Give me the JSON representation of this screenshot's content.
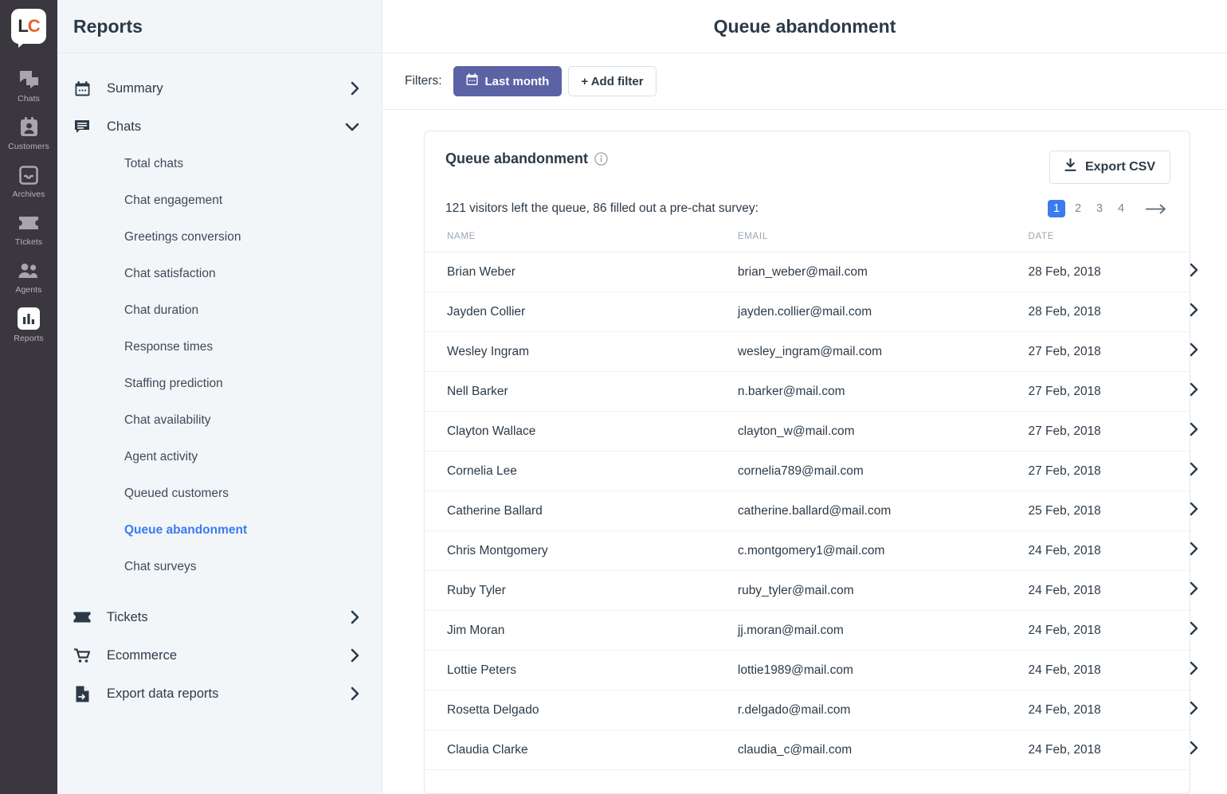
{
  "rail": {
    "logo": {
      "left": "L",
      "right": "C",
      "name": "livechat-logo"
    },
    "items": [
      {
        "label": "Chats",
        "icon": "chats-icon",
        "active": false
      },
      {
        "label": "Customers",
        "icon": "customers-icon",
        "active": false
      },
      {
        "label": "Archives",
        "icon": "archives-icon",
        "active": false
      },
      {
        "label": "TIckets",
        "icon": "tickets-icon",
        "active": false
      },
      {
        "label": "Agents",
        "icon": "agents-icon",
        "active": false
      },
      {
        "label": "Reports",
        "icon": "reports-icon",
        "active": true
      }
    ]
  },
  "sidebar": {
    "title": "Reports",
    "groups": [
      {
        "label": "Summary",
        "icon": "calendar-icon",
        "chevron": "right"
      },
      {
        "label": "Chats",
        "icon": "chat-bubble-icon",
        "chevron": "down"
      }
    ],
    "chats_sub": [
      {
        "label": "Total chats",
        "active": false
      },
      {
        "label": "Chat engagement",
        "active": false
      },
      {
        "label": "Greetings conversion",
        "active": false
      },
      {
        "label": "Chat satisfaction",
        "active": false
      },
      {
        "label": "Chat duration",
        "active": false
      },
      {
        "label": "Response times",
        "active": false
      },
      {
        "label": "Staffing prediction",
        "active": false
      },
      {
        "label": "Chat availability",
        "active": false
      },
      {
        "label": "Agent activity",
        "active": false
      },
      {
        "label": "Queued customers",
        "active": false
      },
      {
        "label": "Queue abandonment",
        "active": true
      },
      {
        "label": "Chat surveys",
        "active": false
      }
    ],
    "groups_bottom": [
      {
        "label": "Tickets",
        "icon": "ticket-icon",
        "chevron": "right"
      },
      {
        "label": "Ecommerce",
        "icon": "cart-icon",
        "chevron": "right"
      },
      {
        "label": "Export data reports",
        "icon": "export-file-icon",
        "chevron": "right"
      }
    ]
  },
  "header": {
    "title": "Queue abandonment"
  },
  "filters": {
    "label": "Filters:",
    "active_filter": "Last month",
    "add_filter": "+ Add filter"
  },
  "card": {
    "title": "Queue abandonment",
    "export_label": "Export CSV",
    "summary": "121 visitors left the queue, 86 filled out a pre-chat survey:",
    "pagination": {
      "pages": [
        "1",
        "2",
        "3",
        "4"
      ],
      "current": "1",
      "next_icon": "arrow-right-icon"
    },
    "columns": [
      "NAME",
      "EMAIL",
      "DATE"
    ],
    "rows": [
      {
        "name": "Brian Weber",
        "email": "brian_weber@mail.com",
        "date": "28 Feb, 2018"
      },
      {
        "name": "Jayden Collier",
        "email": "jayden.collier@mail.com",
        "date": "28 Feb, 2018"
      },
      {
        "name": "Wesley Ingram",
        "email": "wesley_ingram@mail.com",
        "date": "27 Feb, 2018"
      },
      {
        "name": "Nell Barker",
        "email": "n.barker@mail.com",
        "date": "27 Feb, 2018"
      },
      {
        "name": "Clayton Wallace",
        "email": "clayton_w@mail.com",
        "date": "27 Feb, 2018"
      },
      {
        "name": "Cornelia Lee",
        "email": "cornelia789@mail.com",
        "date": "27 Feb, 2018"
      },
      {
        "name": "Catherine Ballard",
        "email": "catherine.ballard@mail.com",
        "date": "25 Feb, 2018"
      },
      {
        "name": "Chris Montgomery",
        "email": "c.montgomery1@mail.com",
        "date": "24 Feb, 2018"
      },
      {
        "name": "Ruby Tyler",
        "email": "ruby_tyler@mail.com",
        "date": "24 Feb, 2018"
      },
      {
        "name": "Jim Moran",
        "email": "jj.moran@mail.com",
        "date": "24 Feb, 2018"
      },
      {
        "name": "Lottie Peters",
        "email": "lottie1989@mail.com",
        "date": "24 Feb, 2018"
      },
      {
        "name": "Rosetta Delgado",
        "email": "r.delgado@mail.com",
        "date": "24 Feb, 2018"
      },
      {
        "name": "Claudia Clarke",
        "email": "claudia_c@mail.com",
        "date": "24 Feb, 2018"
      }
    ]
  },
  "colors": {
    "rail_bg": "#3a373f",
    "sidebar_bg": "#f2f6f9",
    "accent_blue": "#3a7bf0",
    "filter_purple": "#5b63a5",
    "logo_orange": "#e4622c",
    "text_dark": "#2c3a47"
  }
}
